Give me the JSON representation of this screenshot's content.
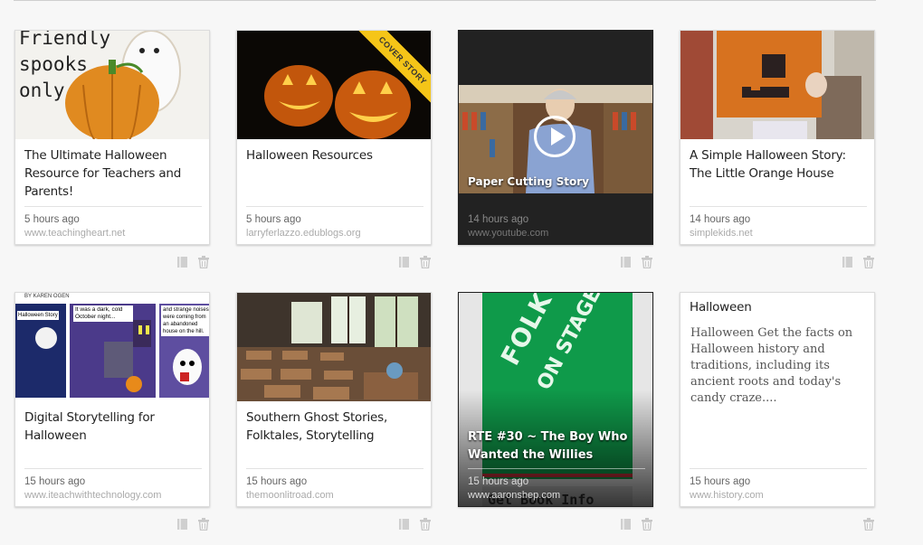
{
  "cards": [
    {
      "title": "The Ultimate Halloween Resource for Teachers and Parents!",
      "time": "5 hours ago",
      "source": "www.teachingheart.net",
      "thumb_text_1": "Friendly",
      "thumb_text_2": "spooks",
      "thumb_text_3": "only"
    },
    {
      "title": "Halloween Resources",
      "time": "5 hours ago",
      "source": "larryferlazzo.edublogs.org",
      "ribbon": "COVER STORY"
    },
    {
      "title": "Paper Cutting Story",
      "time": "14 hours ago",
      "source": "www.youtube.com"
    },
    {
      "title": "A Simple Halloween Story: The Little Orange House",
      "time": "14 hours ago",
      "source": "simplekids.net"
    },
    {
      "title": "Digital Storytelling for Halloween",
      "time": "15 hours ago",
      "source": "www.iteachwithtechnology.com",
      "comic_1": "It was a dark, cold October night...",
      "comic_2": "and strange noises were coming from an abandoned house on the hill.",
      "comic_0": "Halloween Story",
      "comic_by": "BY KAREN OGEN"
    },
    {
      "title": "Southern Ghost Stories, Folktales, Storytelling",
      "time": "15 hours ago",
      "source": "themoonlitroad.com"
    },
    {
      "title": "RTE #30 ~ The Boy Who Wanted the Willies",
      "time": "15 hours ago",
      "source": "www.aaronshep.com",
      "book_1": "FOLKTALES",
      "book_2": "ON STAGE",
      "book_3": "Get Book Info"
    },
    {
      "title": "Halloween",
      "description": "Halloween Get the facts on Halloween history and traditions, including its ancient roots and today's candy craze....",
      "time": "15 hours ago",
      "source": "www.history.com"
    }
  ],
  "icons": {
    "bookmark": "bookmark-icon",
    "trash": "trash-icon",
    "play": "play-icon"
  }
}
